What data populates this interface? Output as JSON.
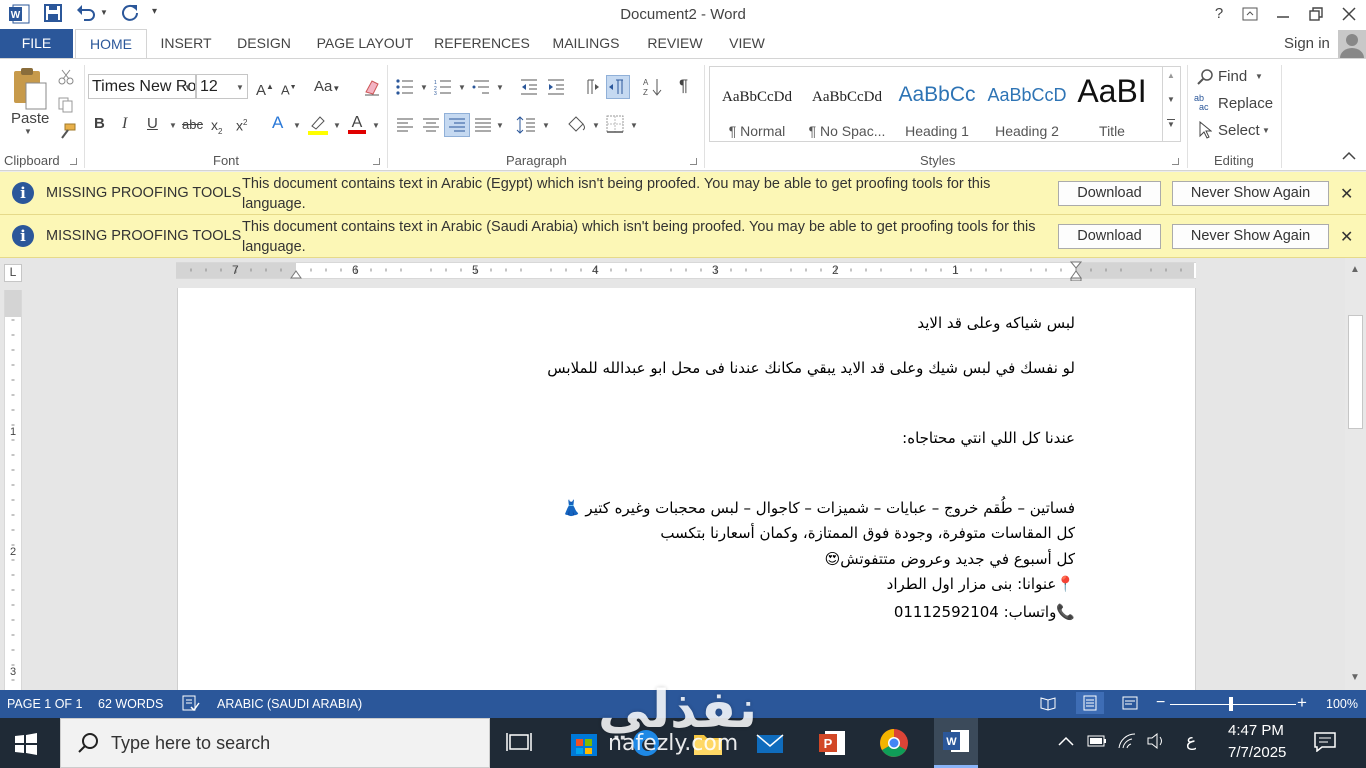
{
  "app": {
    "title": "Document2 - Word",
    "help": "?",
    "signin": "Sign in"
  },
  "tabs": [
    "FILE",
    "HOME",
    "INSERT",
    "DESIGN",
    "PAGE LAYOUT",
    "REFERENCES",
    "MAILINGS",
    "REVIEW",
    "VIEW"
  ],
  "ribbon": {
    "clipboard": {
      "label": "Clipboard",
      "paste": "Paste"
    },
    "font": {
      "label": "Font",
      "family": "Times New Ro",
      "size": "12"
    },
    "paragraph": {
      "label": "Paragraph"
    },
    "styles": {
      "label": "Styles",
      "items": [
        {
          "sample": "AaBbCcDd",
          "name": "¶ Normal"
        },
        {
          "sample": "AaBbCcDd",
          "name": "¶ No Spac..."
        },
        {
          "sample": "AaBbCc",
          "name": "Heading 1"
        },
        {
          "sample": "AaBbCcD",
          "name": "Heading 2"
        },
        {
          "sample": "AaBI",
          "name": "Title"
        }
      ]
    },
    "editing": {
      "label": "Editing",
      "find": "Find",
      "replace": "Replace",
      "select": "Select"
    }
  },
  "message_bars": [
    {
      "title": "MISSING PROOFING TOOLS",
      "text": "This document contains text in Arabic (Egypt) which isn't being proofed. You may be able to get proofing tools for this language.",
      "download": "Download",
      "never": "Never Show Again",
      "close": "✕"
    },
    {
      "title": "MISSING PROOFING TOOLS",
      "text": "This document contains text in Arabic (Saudi Arabia) which isn't being proofed. You may be able to get proofing tools for this language.",
      "download": "Download",
      "never": "Never Show Again",
      "close": "✕"
    }
  ],
  "ruler": {
    "h_numbers": [
      "7",
      "6",
      "5",
      "4",
      "3",
      "2",
      "1"
    ],
    "v_numbers": [
      "1",
      "2",
      "3"
    ],
    "tab_selector": "L"
  },
  "document": {
    "lines": [
      "لبس شياكه وعلى قد الايد",
      "لو نفسك في لبس  شيك وعلى قد الايد يبقي مكانك عندنا فى محل ابو  عبدالله للملابس",
      "عندنا كل اللي انتي محتاجاه:",
      "فساتين – طُقم خروج – عبايات – شميزات – كاجوال – لبس محجبات وغيره كتير 👗",
      "كل المقاسات متوفرة، وجودة فوق الممتازة، وكمان أسعارنا بتكسب",
      "كل أسبوع في جديد وعروض متتفوتش😍",
      "📍عنوانا: بنى مزار اول الطراد",
      "📞واتساب: 01112592104"
    ]
  },
  "status": {
    "page": "PAGE 1 OF 1",
    "words": "62 WORDS",
    "language": "ARABIC (SAUDI ARABIA)",
    "zoom": "100%"
  },
  "taskbar": {
    "search_placeholder": "Type here to search",
    "time": "4:47 PM",
    "date": "7/7/2025",
    "ime": "ع"
  },
  "watermark": {
    "main": "نفذلي",
    "sub": "nafezly.com"
  }
}
